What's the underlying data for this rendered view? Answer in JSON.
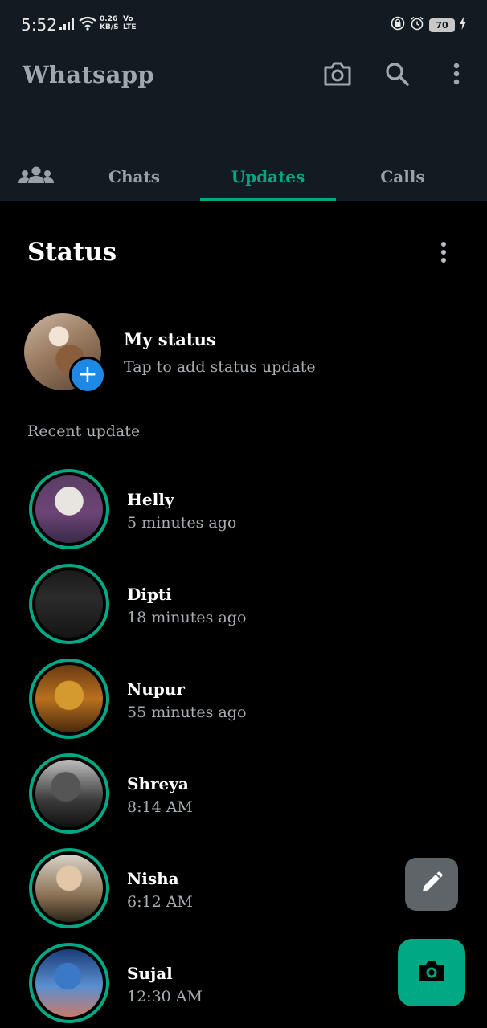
{
  "status_bar": {
    "time": "5:52",
    "net_speed_value": "0.26",
    "net_speed_unit": "KB/S",
    "network_line1": "Vo",
    "network_line2": "LTE",
    "battery": "70"
  },
  "app_bar": {
    "title": "Whatsapp",
    "actions": [
      "camera-icon",
      "search-icon",
      "more-vert-icon"
    ]
  },
  "tabs": [
    {
      "icon": "communities-icon"
    },
    {
      "label": "Chats"
    },
    {
      "label": "Updates",
      "active": true
    },
    {
      "label": "Calls"
    }
  ],
  "status": {
    "title": "Status",
    "my_status": {
      "name": "My status",
      "subtitle": "Tap to add status update"
    },
    "recent_label": "Recent update",
    "updates": [
      {
        "name": "Helly",
        "time": "5 minutes ago"
      },
      {
        "name": "Dipti",
        "time": "18 minutes ago"
      },
      {
        "name": "Nupur",
        "time": "55 minutes ago"
      },
      {
        "name": "Shreya",
        "time": "8:14 AM"
      },
      {
        "name": "Nisha",
        "time": "6:12 AM"
      },
      {
        "name": "Sujal",
        "time": "12:30 AM"
      }
    ]
  },
  "fabs": {
    "edit": "pencil-icon",
    "camera": "camera-icon"
  },
  "colors": {
    "accent": "#00a884",
    "bar_bg": "#121b22",
    "background": "#000000",
    "secondary_text": "#a8aeb2"
  }
}
